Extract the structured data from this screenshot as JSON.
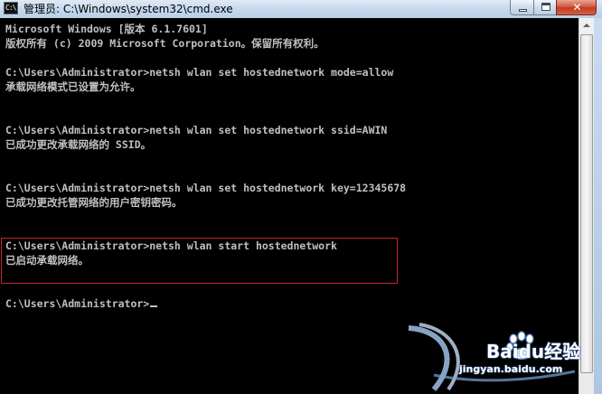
{
  "window": {
    "title": "管理员: C:\\Windows\\system32\\cmd.exe",
    "icon_name": "cmd-icon",
    "icon_text": "C:\\",
    "controls": {
      "minimize_icon": "minimize-icon",
      "maximize_icon": "maximize-icon",
      "close_icon": "close-icon",
      "close_glyph": "✕"
    }
  },
  "console": {
    "lines": [
      "Microsoft Windows [版本 6.1.7601]",
      "版权所有 (c) 2009 Microsoft Corporation。保留所有权利。",
      "",
      "C:\\Users\\Administrator>netsh wlan set hostednetwork mode=allow",
      "承载网络模式已设置为允许。",
      "",
      "",
      "C:\\Users\\Administrator>netsh wlan set hostednetwork ssid=AWIN",
      "已成功更改承载网络的 SSID。",
      "",
      "",
      "C:\\Users\\Administrator>netsh wlan set hostednetwork key=12345678",
      "已成功更改托管网络的用户密钥密码。",
      "",
      "",
      "C:\\Users\\Administrator>netsh wlan start hostednetwork",
      "已启动承载网络。",
      "",
      "",
      "C:\\Users\\Administrator>"
    ],
    "text_color": "#c0c0c0",
    "background_color": "#000000",
    "highlight_color": "#c8232c"
  },
  "watermark": {
    "brand": "Baidu经验",
    "url": "jingyan.baidu.com"
  }
}
